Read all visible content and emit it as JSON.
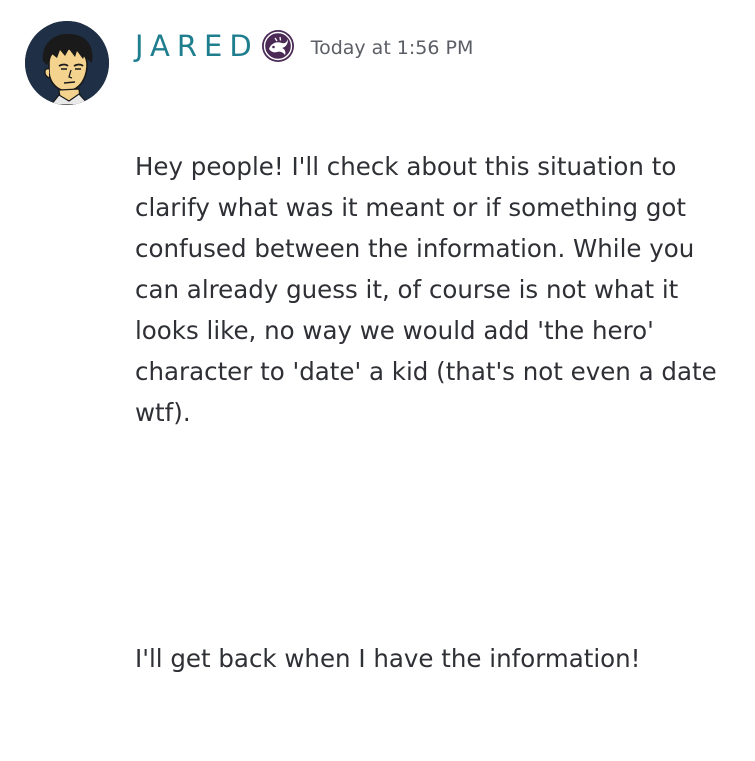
{
  "message": {
    "author": {
      "name": "JARED",
      "name_color": "#1f7e8e",
      "avatar_icon": "avatar-drawing-icon",
      "role_icon": "role-badge-icon"
    },
    "timestamp": "Today at 1:56 PM",
    "paragraphs": [
      "Hey people! I'll check about this situation to clarify what was it meant or if something got confused between the information. While you can already guess it, of course is not what it looks like, no way we would add 'the hero' character to 'date' a kid (that's not even a date wtf).",
      "I'll get back when I have the information!"
    ]
  }
}
